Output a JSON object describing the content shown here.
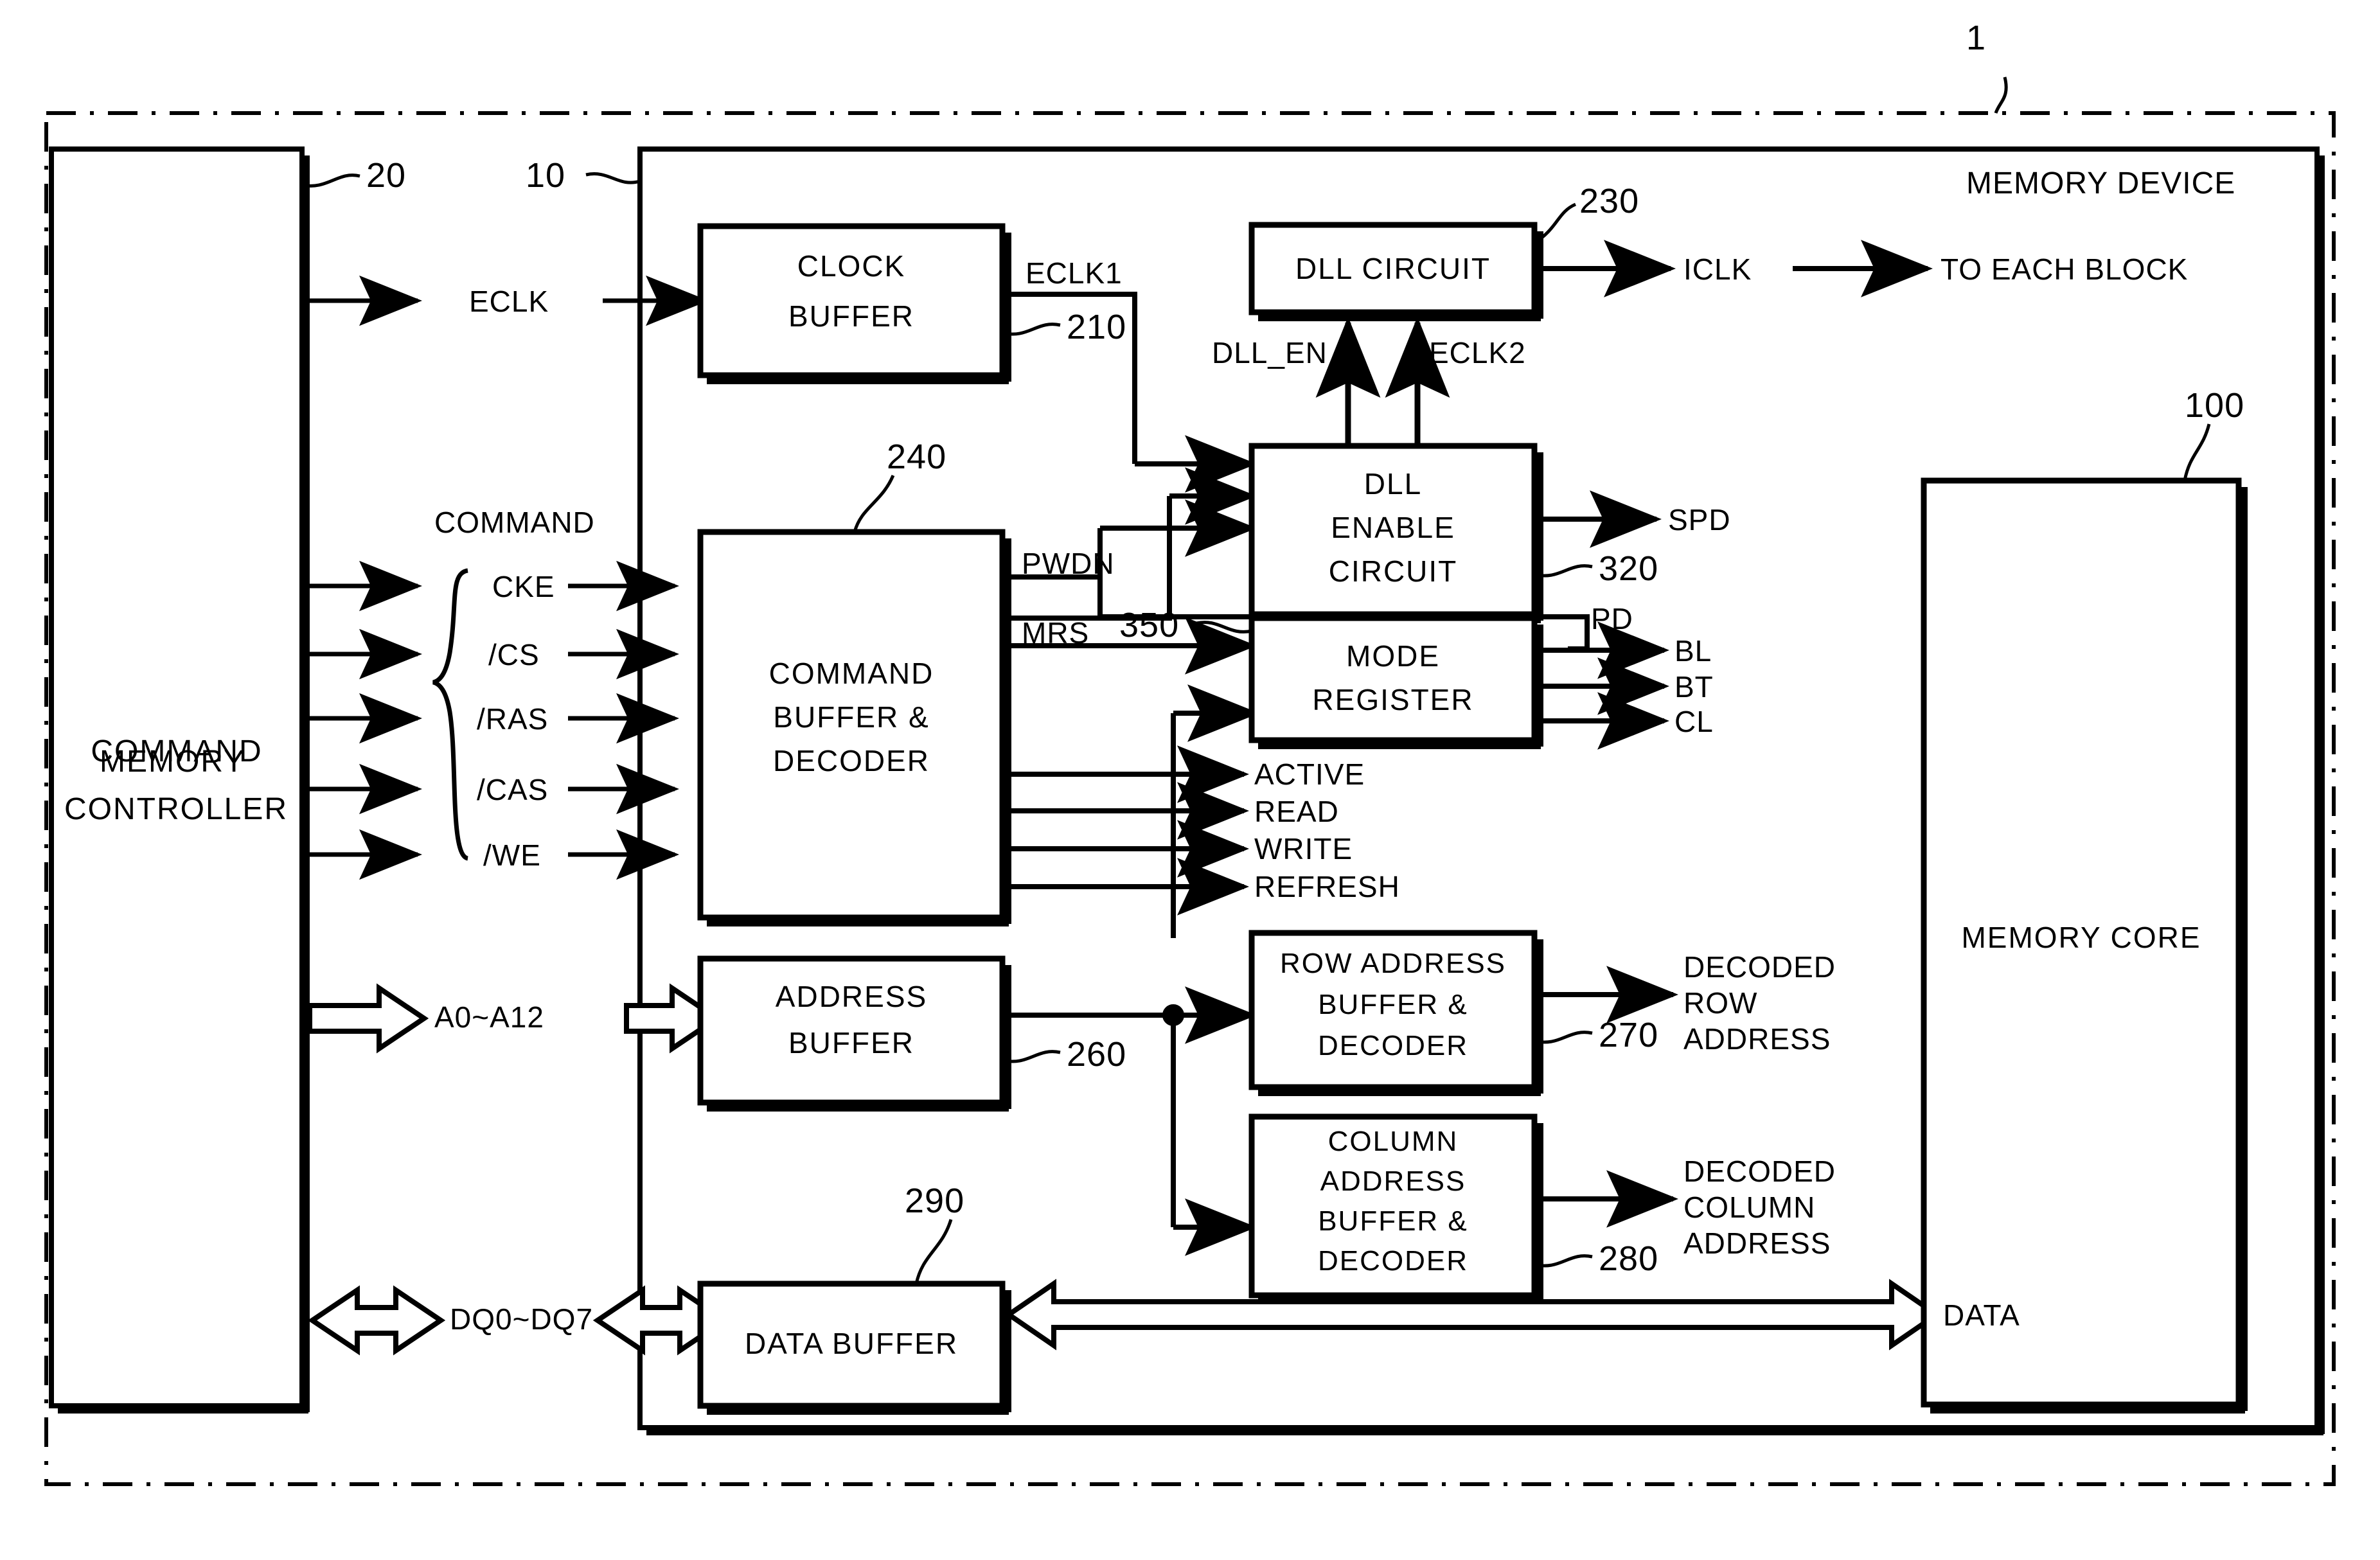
{
  "figure": {
    "top_ref": "1",
    "outer_label": "",
    "memory_device_label": "MEMORY DEVICE"
  },
  "blocks": {
    "memory_controller": {
      "label": "MEMORY CONTROLLER",
      "ref": "20"
    },
    "memory_device": {
      "label": "MEMORY DEVICE",
      "ref": "10"
    },
    "clock_buffer": {
      "label": "CLOCK\nBUFFER",
      "line1": "CLOCK",
      "line2": "BUFFER",
      "ref": "210"
    },
    "command_decoder": {
      "line1": "COMMAND",
      "line2": "BUFFER &",
      "line3": "DECODER",
      "ref": "240"
    },
    "dll_circuit": {
      "label": "DLL CIRCUIT",
      "ref": "230"
    },
    "dll_enable": {
      "line1": "DLL",
      "line2": "ENABLE",
      "line3": "CIRCUIT",
      "ref": "320"
    },
    "mode_register": {
      "line1": "MODE",
      "line2": "REGISTER",
      "ref": "350"
    },
    "address_buffer": {
      "line1": "ADDRESS",
      "line2": "BUFFER",
      "ref": "260"
    },
    "row_addr_decoder": {
      "line1": "ROW ADDRESS",
      "line2": "BUFFER &",
      "line3": "DECODER",
      "ref": "270"
    },
    "col_addr_decoder": {
      "line1": "COLUMN",
      "line2": "ADDRESS",
      "line3": "BUFFER &",
      "line4": "DECODER",
      "ref": "280"
    },
    "data_buffer": {
      "label": "DATA BUFFER",
      "ref": "290"
    },
    "memory_core": {
      "label": "MEMORY CORE",
      "ref": "100"
    }
  },
  "signals": {
    "eclk": "ECLK",
    "eclk1": "ECLK1",
    "eclk2": "ECLK2",
    "iclk": "ICLK",
    "to_each_block": "TO EACH BLOCK",
    "dll_en": "DLL_EN",
    "spd": "SPD",
    "pd": "PD",
    "pwdn": "PWDN",
    "mrs": "MRS",
    "bl": "BL",
    "bt": "BT",
    "cl": "CL",
    "active": "ACTIVE",
    "read": "READ",
    "write": "WRITE",
    "refresh": "REFRESH",
    "address_bus": "A0~A12",
    "data_bus": "DQ0~DQ7",
    "data": "DATA",
    "command_group": "COMMAND",
    "decoded_row_l1": "DECODED",
    "decoded_row_l2": "ROW",
    "decoded_row_l3": "ADDRESS",
    "decoded_col_l1": "DECODED",
    "decoded_col_l2": "COLUMN",
    "decoded_col_l3": "ADDRESS"
  },
  "command_signals": [
    "CKE",
    "/CS",
    "/RAS",
    "/CAS",
    "/WE"
  ],
  "colors": {
    "ink": "#000000",
    "paper": "#ffffff"
  }
}
